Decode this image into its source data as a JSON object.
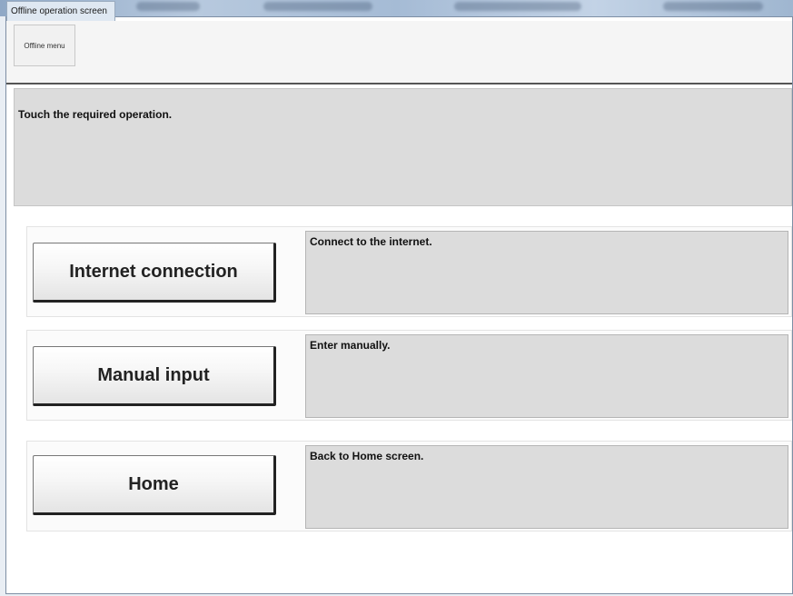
{
  "window": {
    "title": "Offline operation screen"
  },
  "menubar": {
    "offline_menu_label": "Offline menu"
  },
  "instruction": {
    "text": "Touch the required operation."
  },
  "options": [
    {
      "button_label": "Internet connection",
      "description": "Connect to the internet."
    },
    {
      "button_label": "Manual input",
      "description": "Enter manually."
    },
    {
      "button_label": "Home",
      "description": "Back to Home screen."
    }
  ],
  "colors": {
    "panel_gray": "#dcdcdc",
    "button_border": "#222222",
    "window_border": "#7d8ea4"
  }
}
